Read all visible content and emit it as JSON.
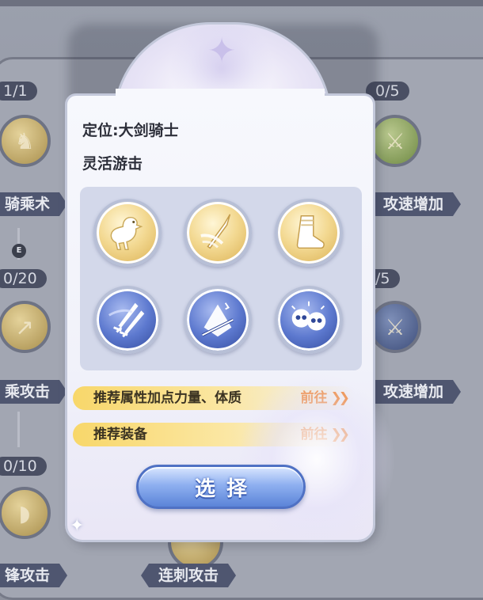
{
  "background": {
    "counters": [
      "1/1",
      "0/5",
      "0/20",
      "/5",
      "0/10"
    ],
    "labels": [
      "骑乘术",
      "攻速增加",
      "乘攻击",
      "攻速增加",
      "锋攻击",
      "连刺攻击"
    ],
    "e_marker": "E"
  },
  "popup": {
    "role_title": "定位:大剑骑士",
    "role_subtitle": "灵活游击",
    "skills": [
      {
        "icon": "chocobo-mount-icon",
        "color": "gold"
      },
      {
        "icon": "spear-slash-icon",
        "color": "gold"
      },
      {
        "icon": "boot-icon",
        "color": "gold"
      },
      {
        "icon": "double-sword-icon",
        "color": "blue"
      },
      {
        "icon": "blade-shield-icon",
        "color": "blue"
      },
      {
        "icon": "double-skull-icon",
        "color": "blue"
      }
    ],
    "recommendations": [
      {
        "text": "推荐属性加点力量、体质",
        "go": "前往"
      },
      {
        "text": "推荐装备",
        "go": "前往"
      }
    ],
    "select_label": "选择"
  },
  "colors": {
    "gold_row": "#f8d76a",
    "go_text": "#f08a3c",
    "button_blue": "#5b84d8"
  }
}
